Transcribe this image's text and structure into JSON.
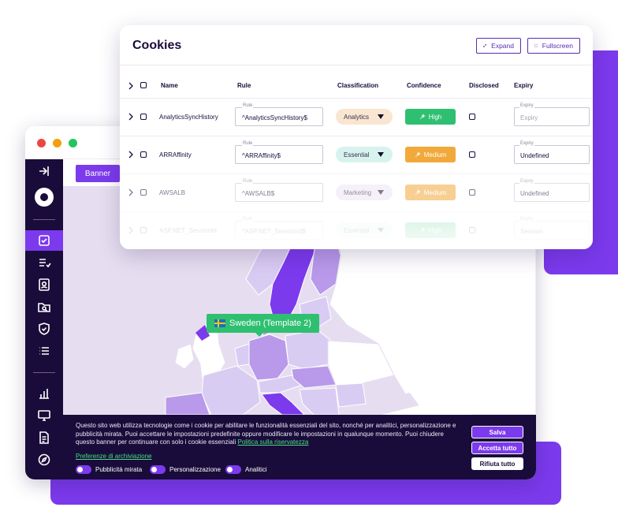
{
  "browser": {
    "tab_label": "Banner"
  },
  "sidebar": {
    "icons": [
      "collapse-icon",
      "logo-icon",
      "checkbox-icon",
      "checklist-icon",
      "user-card-icon",
      "search-folder-icon",
      "shield-icon",
      "list-icon",
      "bar-chart-icon",
      "monitor-icon",
      "document-icon",
      "compass-icon"
    ],
    "active_index": 2
  },
  "map": {
    "tooltip_label": "Sweden (Template 2)",
    "tooltip_flag": "sweden-flag",
    "region_colors": {
      "background": "#e6def0",
      "land": "#ffffff",
      "light": "#d9ccf2",
      "medium": "#b999ea",
      "dark": "#7c3aed"
    }
  },
  "cookie_banner": {
    "text": "Questo sito web utilizza tecnologie come i cookie per abilitare le funzionalità essenziali del sito, nonché per analitici, personalizzazione e pubblicità mirata. Puoi accettare le impostazioni predefinite oppure modificare le impostazioni in qualunque momento. Puoi chiudere questo banner per continuare con solo i cookie essenziali",
    "policy_link": "Politica sulla riservatezza",
    "preferences_link": "Preferenze di archiviazione",
    "toggles": [
      {
        "label": "Pubblicità mirata"
      },
      {
        "label": "Personalizzazione"
      },
      {
        "label": "Analitici"
      }
    ],
    "buttons": {
      "save": "Salva",
      "accept_all": "Accetta tutto",
      "reject_all": "Rifiuta tutto"
    }
  },
  "cookies_panel": {
    "title": "Cookies",
    "expand_label": "Expand",
    "fullscreen_label": "Fullscreen",
    "columns": {
      "name": "Name",
      "rule": "Rule",
      "classification": "Classification",
      "confidence": "Confidence",
      "disclosed": "Disclosed",
      "expiry": "Expiry"
    },
    "rule_field_label": "Rule",
    "expiry_field_label": "Expiry",
    "rows": [
      {
        "name": "AnalyticsSyncHistory",
        "rule": "^AnalyticsSyncHistory$",
        "classification": "Analytics",
        "confidence": "High",
        "expiry": "Expiry"
      },
      {
        "name": "ARRAffinity",
        "rule": "^ARRAffinity$",
        "classification": "Essential",
        "confidence": "Medium",
        "expiry": "Undefined"
      },
      {
        "name": "AWSALB",
        "rule": "^AWSALB$",
        "classification": "Marketing",
        "confidence": "Medium",
        "expiry": "Undefined"
      },
      {
        "name": "ASP.NET_SessionId",
        "rule": "^ASP.NET_SessionId$",
        "classification": "Essential",
        "confidence": "High",
        "expiry": "Session"
      }
    ],
    "classification_colors": {
      "Analytics": "#f8e6d0",
      "Essential": "#d7f3ee",
      "Marketing": "#ece7f4"
    },
    "confidence_colors": {
      "High": "#2fbf71",
      "Medium": "#f2a93b"
    }
  },
  "colors": {
    "brand_purple": "#7c3aed",
    "navy": "#190c3a",
    "success_green": "#2fbf71",
    "link_green": "#4ade80"
  }
}
